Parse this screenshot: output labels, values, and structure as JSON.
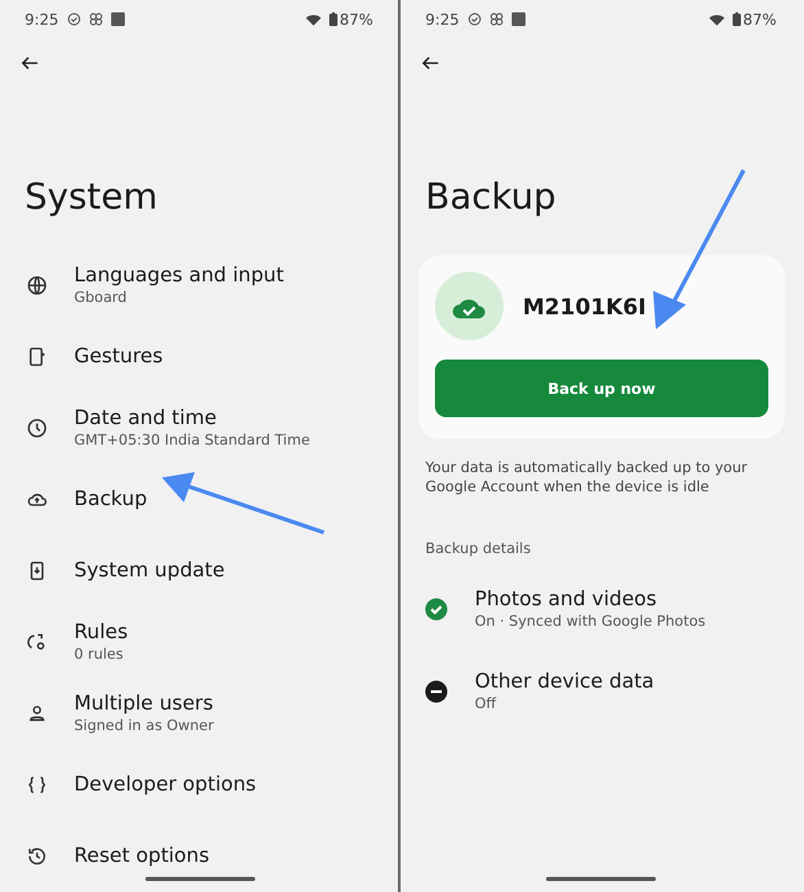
{
  "screens": [
    {
      "status_bar": {
        "time": "9:25",
        "battery": "87%"
      },
      "title": "System",
      "items": [
        {
          "label": "Languages and input",
          "subtitle": "Gboard"
        },
        {
          "label": "Gestures"
        },
        {
          "label": "Date and time",
          "subtitle": "GMT+05:30 India Standard Time"
        },
        {
          "label": "Backup"
        },
        {
          "label": "System update"
        },
        {
          "label": "Rules",
          "subtitle": "0 rules"
        },
        {
          "label": "Multiple users",
          "subtitle": "Signed in as Owner"
        },
        {
          "label": "Developer options"
        },
        {
          "label": "Reset options"
        }
      ]
    },
    {
      "status_bar": {
        "time": "9:25",
        "battery": "87%"
      },
      "title": "Backup",
      "device": {
        "name": "M2101K6I",
        "button": "Back up now"
      },
      "description": "Your data is automatically backed up to your Google Account when the device is idle",
      "section": "Backup details",
      "details": [
        {
          "label": "Photos and videos",
          "subtitle": "On · Synced with Google Photos",
          "on": true
        },
        {
          "label": "Other device data",
          "subtitle": "Off",
          "on": false
        }
      ]
    }
  ]
}
